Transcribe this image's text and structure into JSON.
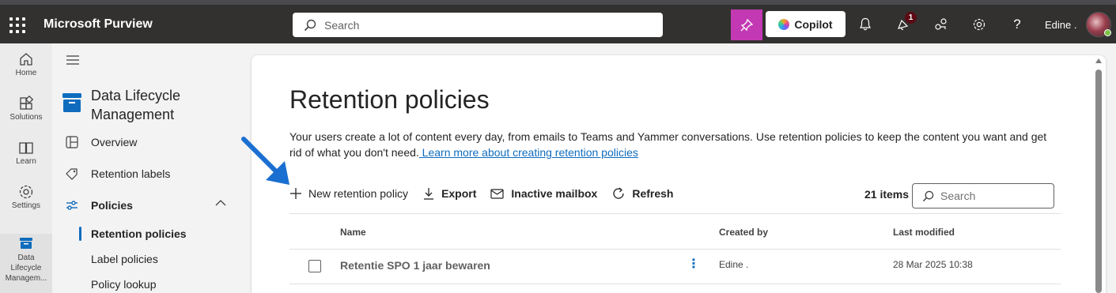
{
  "app": {
    "name": "Microsoft Purview"
  },
  "topbar": {
    "search_placeholder": "Search",
    "copilot_label": "Copilot",
    "notification_count": "1",
    "user_name": "Edine ."
  },
  "rail": {
    "items": [
      {
        "label": "Home",
        "icon": "home-icon"
      },
      {
        "label": "Solutions",
        "icon": "solutions-icon"
      },
      {
        "label": "Learn",
        "icon": "book-icon"
      },
      {
        "label": "Settings",
        "icon": "gear-icon"
      },
      {
        "label": "Data Lifecycle Managem...",
        "icon": "archive-icon",
        "active": true
      }
    ]
  },
  "nav": {
    "title": "Data Lifecycle Management",
    "items": [
      {
        "label": "Overview",
        "icon": "overview-icon"
      },
      {
        "label": "Retention labels",
        "icon": "tag-icon"
      },
      {
        "label": "Policies",
        "icon": "policies-icon"
      }
    ],
    "sub_items": [
      {
        "label": "Retention policies",
        "active": true
      },
      {
        "label": "Label policies"
      },
      {
        "label": "Policy lookup"
      }
    ]
  },
  "main": {
    "title": "Retention policies",
    "description": "Your users create a lot of content every day, from emails to Teams and Yammer conversations. Use retention policies to keep the content you want and get rid of what you don't need.",
    "learn_more": " Learn more about creating retention policies",
    "toolbar": {
      "new_label": "New retention policy",
      "export_label": "Export",
      "inactive_label": "Inactive mailbox",
      "refresh_label": "Refresh"
    },
    "items_count": "21 items",
    "search_placeholder": "Search",
    "table": {
      "columns": [
        "Name",
        "Created by",
        "Last modified"
      ],
      "rows": [
        {
          "name": "Retentie SPO 1 jaar bewaren",
          "created_by": "Edine .",
          "last_modified": "28 Mar 2025 10:38"
        }
      ]
    }
  },
  "colors": {
    "topbar": "#323130",
    "accent": "#0f6cbd",
    "pin_button": "#c239b3",
    "annotation_arrow": "#1a6fd1"
  }
}
